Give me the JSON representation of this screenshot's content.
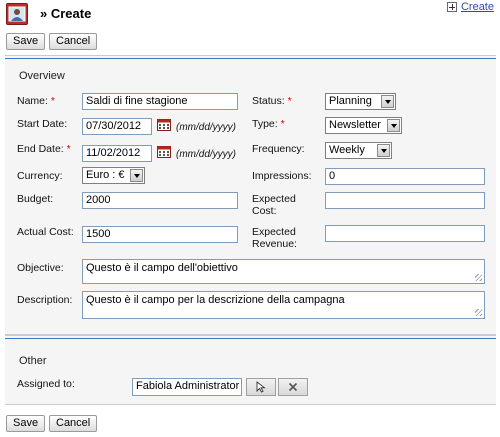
{
  "header": {
    "title": "» Create",
    "create_link": "Create"
  },
  "toolbar": {
    "save_label": "Save",
    "cancel_label": "Cancel"
  },
  "overview": {
    "section_title": "Overview",
    "name": {
      "label": "Name:",
      "value": "Saldi di fine stagione"
    },
    "start_date": {
      "label": "Start Date:",
      "value": "07/30/2012",
      "hint": "(mm/dd/yyyy)"
    },
    "end_date": {
      "label": "End Date:",
      "value": "11/02/2012",
      "hint": "(mm/dd/yyyy)"
    },
    "currency": {
      "label": "Currency:",
      "value": "Euro : €"
    },
    "budget": {
      "label": "Budget:",
      "value": "2000"
    },
    "actual_cost": {
      "label": "Actual Cost:",
      "value": "1500"
    },
    "status": {
      "label": "Status:",
      "value": "Planning"
    },
    "type": {
      "label": "Type:",
      "value": "Newsletter"
    },
    "frequency": {
      "label": "Frequency:",
      "value": "Weekly"
    },
    "impressions": {
      "label": "Impressions:",
      "value": "0"
    },
    "expected_cost": {
      "label_line1": "Expected",
      "label_line2": "Cost:",
      "value": ""
    },
    "expected_revenue": {
      "label_line1": "Expected",
      "label_line2": "Revenue:",
      "value": ""
    },
    "objective": {
      "label": "Objective:",
      "value": "Questo è il campo dell'obiettivo"
    },
    "description": {
      "label": "Description:",
      "value": "Questo è il campo per la descrizione della campagna"
    }
  },
  "other": {
    "section_title": "Other",
    "assigned_to": {
      "label": "Assigned to:",
      "value": "Fabiola Administrator"
    }
  },
  "colors": {
    "accent_line": "#3a78c3",
    "required": "#d40000",
    "panel_bg": "#f5f5f5",
    "link": "#2a4fa8"
  },
  "icons": [
    "campaign-icon",
    "plus-icon",
    "calendar-icon",
    "select-cursor-icon",
    "clear-x-icon"
  ]
}
